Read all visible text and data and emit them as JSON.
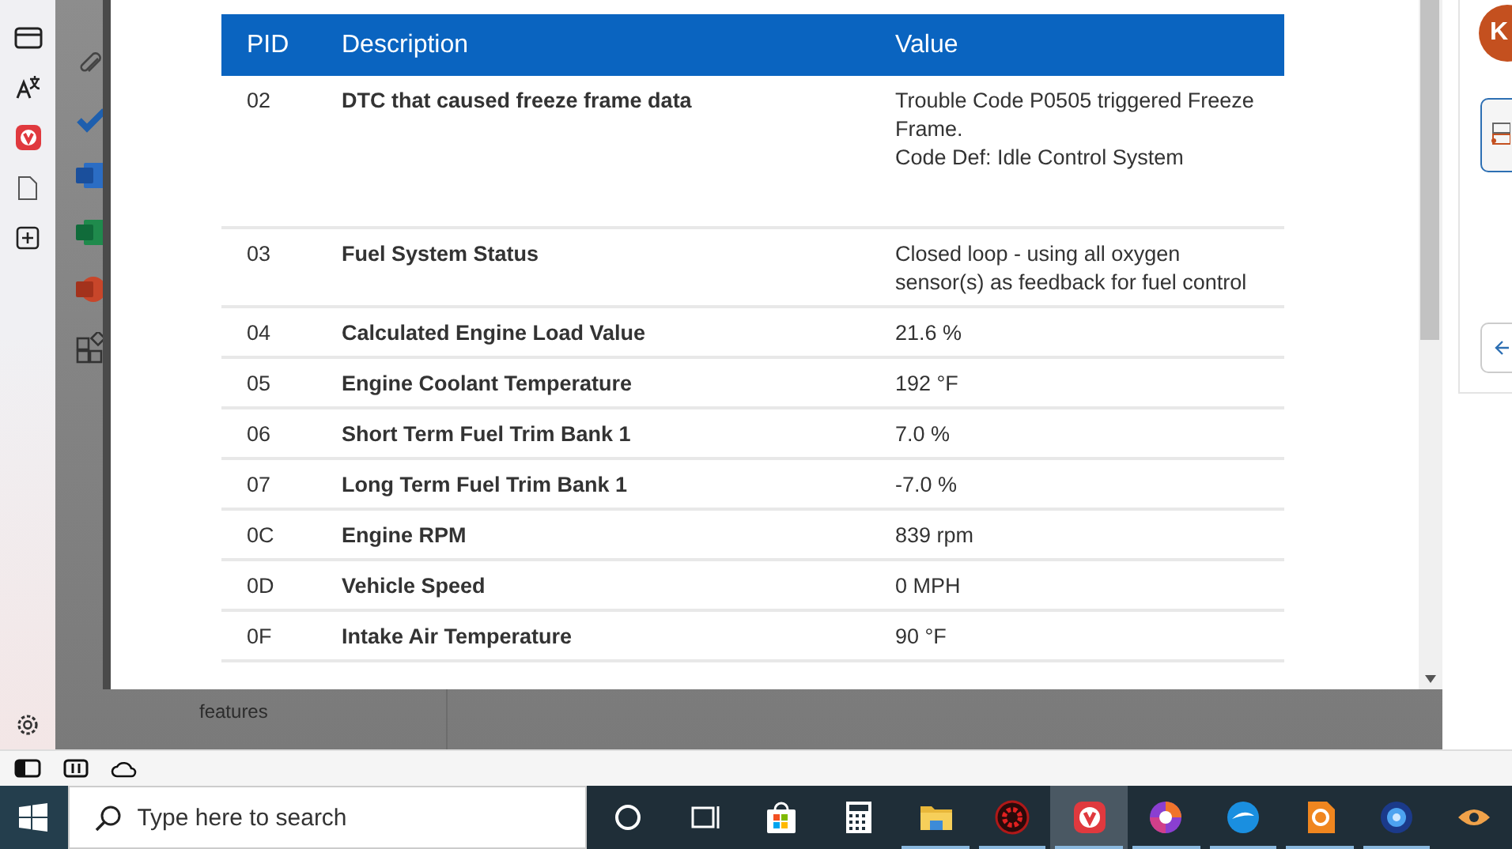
{
  "table": {
    "columns": [
      "PID",
      "Description",
      "Value"
    ],
    "rows": [
      {
        "pid": "02",
        "description": "DTC that caused freeze frame data",
        "value": "Trouble Code P0505 triggered Freeze Frame.\nCode Def: Idle Control System"
      },
      {
        "pid": "03",
        "description": "Fuel System Status",
        "value": "Closed loop - using all oxygen sensor(s) as feedback for fuel control"
      },
      {
        "pid": "04",
        "description": "Calculated Engine Load Value",
        "value": "21.6 %"
      },
      {
        "pid": "05",
        "description": "Engine Coolant Temperature",
        "value": "192 °F"
      },
      {
        "pid": "06",
        "description": "Short Term Fuel Trim Bank 1",
        "value": "7.0 %"
      },
      {
        "pid": "07",
        "description": "Long Term Fuel Trim Bank 1",
        "value": "-7.0 %"
      },
      {
        "pid": "0C",
        "description": "Engine RPM",
        "value": "839 rpm"
      },
      {
        "pid": "0D",
        "description": "Vehicle Speed",
        "value": "0 MPH"
      },
      {
        "pid": "0F",
        "description": "Intake Air Temperature",
        "value": "90 °F"
      }
    ]
  },
  "background": {
    "promo_text": "features"
  },
  "side_panel": {
    "avatar": "K"
  },
  "taskbar": {
    "search": {
      "placeholder": "Type here to search"
    },
    "apps": [
      {
        "kind": "cortana",
        "selected": false,
        "running": false
      },
      {
        "kind": "taskview",
        "selected": false,
        "running": false
      },
      {
        "kind": "store",
        "selected": false,
        "running": false
      },
      {
        "kind": "calculator",
        "selected": false,
        "running": false
      },
      {
        "kind": "folder",
        "selected": false,
        "running": true
      },
      {
        "kind": "gear",
        "selected": false,
        "running": true
      },
      {
        "kind": "vivaldi",
        "selected": true,
        "running": true
      },
      {
        "kind": "swirl",
        "selected": false,
        "running": true
      },
      {
        "kind": "bird",
        "selected": false,
        "running": true
      },
      {
        "kind": "pdf",
        "selected": false,
        "running": true
      },
      {
        "kind": "globe",
        "selected": false,
        "running": true
      },
      {
        "kind": "eye",
        "selected": false,
        "running": false
      }
    ]
  }
}
